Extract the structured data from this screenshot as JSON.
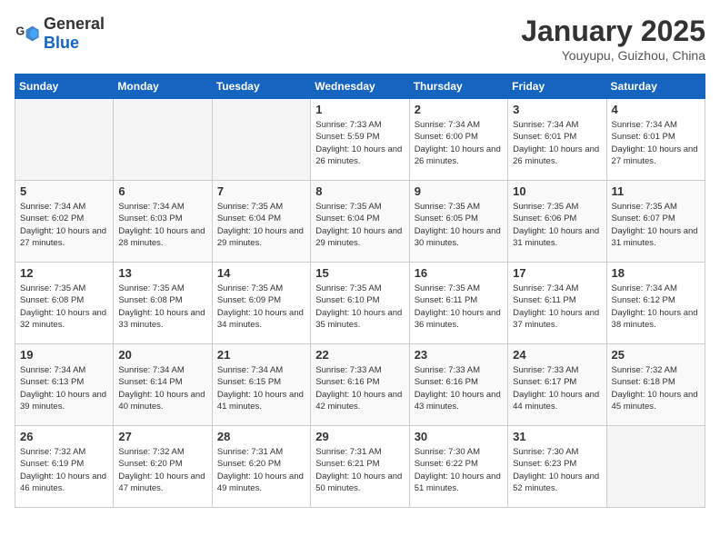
{
  "header": {
    "logo_general": "General",
    "logo_blue": "Blue",
    "month_title": "January 2025",
    "location": "Youyupu, Guizhou, China"
  },
  "weekdays": [
    "Sunday",
    "Monday",
    "Tuesday",
    "Wednesday",
    "Thursday",
    "Friday",
    "Saturday"
  ],
  "weeks": [
    [
      {
        "day": "",
        "empty": true
      },
      {
        "day": "",
        "empty": true
      },
      {
        "day": "",
        "empty": true
      },
      {
        "day": "1",
        "sunrise": "7:33 AM",
        "sunset": "5:59 PM",
        "daylight": "10 hours and 26 minutes."
      },
      {
        "day": "2",
        "sunrise": "7:34 AM",
        "sunset": "6:00 PM",
        "daylight": "10 hours and 26 minutes."
      },
      {
        "day": "3",
        "sunrise": "7:34 AM",
        "sunset": "6:01 PM",
        "daylight": "10 hours and 26 minutes."
      },
      {
        "day": "4",
        "sunrise": "7:34 AM",
        "sunset": "6:01 PM",
        "daylight": "10 hours and 27 minutes."
      }
    ],
    [
      {
        "day": "5",
        "sunrise": "7:34 AM",
        "sunset": "6:02 PM",
        "daylight": "10 hours and 27 minutes."
      },
      {
        "day": "6",
        "sunrise": "7:34 AM",
        "sunset": "6:03 PM",
        "daylight": "10 hours and 28 minutes."
      },
      {
        "day": "7",
        "sunrise": "7:35 AM",
        "sunset": "6:04 PM",
        "daylight": "10 hours and 29 minutes."
      },
      {
        "day": "8",
        "sunrise": "7:35 AM",
        "sunset": "6:04 PM",
        "daylight": "10 hours and 29 minutes."
      },
      {
        "day": "9",
        "sunrise": "7:35 AM",
        "sunset": "6:05 PM",
        "daylight": "10 hours and 30 minutes."
      },
      {
        "day": "10",
        "sunrise": "7:35 AM",
        "sunset": "6:06 PM",
        "daylight": "10 hours and 31 minutes."
      },
      {
        "day": "11",
        "sunrise": "7:35 AM",
        "sunset": "6:07 PM",
        "daylight": "10 hours and 31 minutes."
      }
    ],
    [
      {
        "day": "12",
        "sunrise": "7:35 AM",
        "sunset": "6:08 PM",
        "daylight": "10 hours and 32 minutes."
      },
      {
        "day": "13",
        "sunrise": "7:35 AM",
        "sunset": "6:08 PM",
        "daylight": "10 hours and 33 minutes."
      },
      {
        "day": "14",
        "sunrise": "7:35 AM",
        "sunset": "6:09 PM",
        "daylight": "10 hours and 34 minutes."
      },
      {
        "day": "15",
        "sunrise": "7:35 AM",
        "sunset": "6:10 PM",
        "daylight": "10 hours and 35 minutes."
      },
      {
        "day": "16",
        "sunrise": "7:35 AM",
        "sunset": "6:11 PM",
        "daylight": "10 hours and 36 minutes."
      },
      {
        "day": "17",
        "sunrise": "7:34 AM",
        "sunset": "6:11 PM",
        "daylight": "10 hours and 37 minutes."
      },
      {
        "day": "18",
        "sunrise": "7:34 AM",
        "sunset": "6:12 PM",
        "daylight": "10 hours and 38 minutes."
      }
    ],
    [
      {
        "day": "19",
        "sunrise": "7:34 AM",
        "sunset": "6:13 PM",
        "daylight": "10 hours and 39 minutes."
      },
      {
        "day": "20",
        "sunrise": "7:34 AM",
        "sunset": "6:14 PM",
        "daylight": "10 hours and 40 minutes."
      },
      {
        "day": "21",
        "sunrise": "7:34 AM",
        "sunset": "6:15 PM",
        "daylight": "10 hours and 41 minutes."
      },
      {
        "day": "22",
        "sunrise": "7:33 AM",
        "sunset": "6:16 PM",
        "daylight": "10 hours and 42 minutes."
      },
      {
        "day": "23",
        "sunrise": "7:33 AM",
        "sunset": "6:16 PM",
        "daylight": "10 hours and 43 minutes."
      },
      {
        "day": "24",
        "sunrise": "7:33 AM",
        "sunset": "6:17 PM",
        "daylight": "10 hours and 44 minutes."
      },
      {
        "day": "25",
        "sunrise": "7:32 AM",
        "sunset": "6:18 PM",
        "daylight": "10 hours and 45 minutes."
      }
    ],
    [
      {
        "day": "26",
        "sunrise": "7:32 AM",
        "sunset": "6:19 PM",
        "daylight": "10 hours and 46 minutes."
      },
      {
        "day": "27",
        "sunrise": "7:32 AM",
        "sunset": "6:20 PM",
        "daylight": "10 hours and 47 minutes."
      },
      {
        "day": "28",
        "sunrise": "7:31 AM",
        "sunset": "6:20 PM",
        "daylight": "10 hours and 49 minutes."
      },
      {
        "day": "29",
        "sunrise": "7:31 AM",
        "sunset": "6:21 PM",
        "daylight": "10 hours and 50 minutes."
      },
      {
        "day": "30",
        "sunrise": "7:30 AM",
        "sunset": "6:22 PM",
        "daylight": "10 hours and 51 minutes."
      },
      {
        "day": "31",
        "sunrise": "7:30 AM",
        "sunset": "6:23 PM",
        "daylight": "10 hours and 52 minutes."
      },
      {
        "day": "",
        "empty": true
      }
    ]
  ]
}
